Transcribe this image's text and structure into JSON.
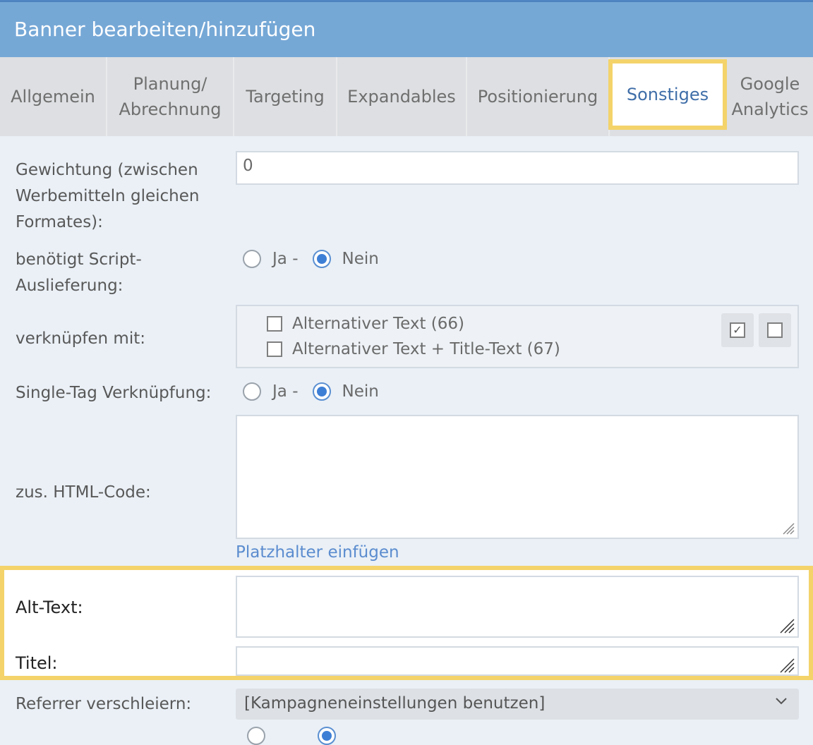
{
  "window": {
    "title": "Banner bearbeiten/hinzufügen"
  },
  "tabs": [
    {
      "label": "Allgemein"
    },
    {
      "label": "Planung/\nAbrechnung"
    },
    {
      "label": "Targeting"
    },
    {
      "label": "Expandables"
    },
    {
      "label": "Positionierung"
    },
    {
      "label": "Sonstiges",
      "active": true
    },
    {
      "label": "Google\nAnalytics"
    }
  ],
  "form": {
    "weight": {
      "label": "Gewichtung (zwischen\nWerbemitteln gleichen\nFormates):",
      "value": "0"
    },
    "script_delivery": {
      "label": "benötigt Script-\nAuslieferung:",
      "options": [
        "Ja -",
        "Nein"
      ],
      "selected": "Nein"
    },
    "link_with": {
      "label": "verknüpfen mit:",
      "options": [
        "Alternativer Text (66)",
        "Alternativer Text + Title-Text (67)"
      ]
    },
    "single_tag": {
      "label": "Single-Tag Verknüpfung:",
      "options": [
        "Ja -",
        "Nein"
      ],
      "selected": "Nein"
    },
    "html_code": {
      "label": "zus. HTML-Code:",
      "value": "",
      "link": "Platzhalter einfügen"
    },
    "alt_text": {
      "label": "Alt-Text:",
      "value": ""
    },
    "title": {
      "label": "Titel:",
      "value": ""
    },
    "referrer": {
      "label": "Referrer verschleiern:",
      "selected": "[Kampagneneinstellungen benutzen]"
    }
  },
  "colors": {
    "header": "#76a8d6",
    "highlight": "#f4d36a",
    "accent": "#3e7fd6"
  }
}
